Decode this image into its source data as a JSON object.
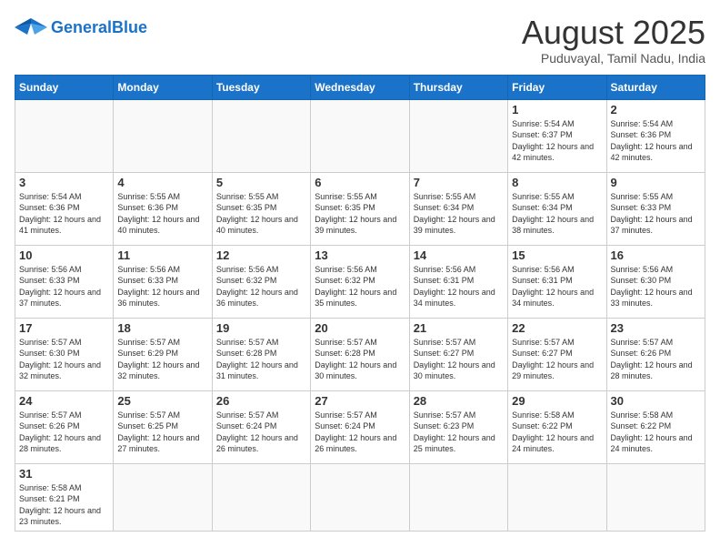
{
  "header": {
    "logo_text_general": "General",
    "logo_text_blue": "Blue",
    "title": "August 2025",
    "subtitle": "Puduvayal, Tamil Nadu, India"
  },
  "days_of_week": [
    "Sunday",
    "Monday",
    "Tuesday",
    "Wednesday",
    "Thursday",
    "Friday",
    "Saturday"
  ],
  "weeks": [
    [
      {
        "day": "",
        "info": ""
      },
      {
        "day": "",
        "info": ""
      },
      {
        "day": "",
        "info": ""
      },
      {
        "day": "",
        "info": ""
      },
      {
        "day": "",
        "info": ""
      },
      {
        "day": "1",
        "info": "Sunrise: 5:54 AM\nSunset: 6:37 PM\nDaylight: 12 hours and 42 minutes."
      },
      {
        "day": "2",
        "info": "Sunrise: 5:54 AM\nSunset: 6:36 PM\nDaylight: 12 hours and 42 minutes."
      }
    ],
    [
      {
        "day": "3",
        "info": "Sunrise: 5:54 AM\nSunset: 6:36 PM\nDaylight: 12 hours and 41 minutes."
      },
      {
        "day": "4",
        "info": "Sunrise: 5:55 AM\nSunset: 6:36 PM\nDaylight: 12 hours and 40 minutes."
      },
      {
        "day": "5",
        "info": "Sunrise: 5:55 AM\nSunset: 6:35 PM\nDaylight: 12 hours and 40 minutes."
      },
      {
        "day": "6",
        "info": "Sunrise: 5:55 AM\nSunset: 6:35 PM\nDaylight: 12 hours and 39 minutes."
      },
      {
        "day": "7",
        "info": "Sunrise: 5:55 AM\nSunset: 6:34 PM\nDaylight: 12 hours and 39 minutes."
      },
      {
        "day": "8",
        "info": "Sunrise: 5:55 AM\nSunset: 6:34 PM\nDaylight: 12 hours and 38 minutes."
      },
      {
        "day": "9",
        "info": "Sunrise: 5:55 AM\nSunset: 6:33 PM\nDaylight: 12 hours and 37 minutes."
      }
    ],
    [
      {
        "day": "10",
        "info": "Sunrise: 5:56 AM\nSunset: 6:33 PM\nDaylight: 12 hours and 37 minutes."
      },
      {
        "day": "11",
        "info": "Sunrise: 5:56 AM\nSunset: 6:33 PM\nDaylight: 12 hours and 36 minutes."
      },
      {
        "day": "12",
        "info": "Sunrise: 5:56 AM\nSunset: 6:32 PM\nDaylight: 12 hours and 36 minutes."
      },
      {
        "day": "13",
        "info": "Sunrise: 5:56 AM\nSunset: 6:32 PM\nDaylight: 12 hours and 35 minutes."
      },
      {
        "day": "14",
        "info": "Sunrise: 5:56 AM\nSunset: 6:31 PM\nDaylight: 12 hours and 34 minutes."
      },
      {
        "day": "15",
        "info": "Sunrise: 5:56 AM\nSunset: 6:31 PM\nDaylight: 12 hours and 34 minutes."
      },
      {
        "day": "16",
        "info": "Sunrise: 5:56 AM\nSunset: 6:30 PM\nDaylight: 12 hours and 33 minutes."
      }
    ],
    [
      {
        "day": "17",
        "info": "Sunrise: 5:57 AM\nSunset: 6:30 PM\nDaylight: 12 hours and 32 minutes."
      },
      {
        "day": "18",
        "info": "Sunrise: 5:57 AM\nSunset: 6:29 PM\nDaylight: 12 hours and 32 minutes."
      },
      {
        "day": "19",
        "info": "Sunrise: 5:57 AM\nSunset: 6:28 PM\nDaylight: 12 hours and 31 minutes."
      },
      {
        "day": "20",
        "info": "Sunrise: 5:57 AM\nSunset: 6:28 PM\nDaylight: 12 hours and 30 minutes."
      },
      {
        "day": "21",
        "info": "Sunrise: 5:57 AM\nSunset: 6:27 PM\nDaylight: 12 hours and 30 minutes."
      },
      {
        "day": "22",
        "info": "Sunrise: 5:57 AM\nSunset: 6:27 PM\nDaylight: 12 hours and 29 minutes."
      },
      {
        "day": "23",
        "info": "Sunrise: 5:57 AM\nSunset: 6:26 PM\nDaylight: 12 hours and 28 minutes."
      }
    ],
    [
      {
        "day": "24",
        "info": "Sunrise: 5:57 AM\nSunset: 6:26 PM\nDaylight: 12 hours and 28 minutes."
      },
      {
        "day": "25",
        "info": "Sunrise: 5:57 AM\nSunset: 6:25 PM\nDaylight: 12 hours and 27 minutes."
      },
      {
        "day": "26",
        "info": "Sunrise: 5:57 AM\nSunset: 6:24 PM\nDaylight: 12 hours and 26 minutes."
      },
      {
        "day": "27",
        "info": "Sunrise: 5:57 AM\nSunset: 6:24 PM\nDaylight: 12 hours and 26 minutes."
      },
      {
        "day": "28",
        "info": "Sunrise: 5:57 AM\nSunset: 6:23 PM\nDaylight: 12 hours and 25 minutes."
      },
      {
        "day": "29",
        "info": "Sunrise: 5:58 AM\nSunset: 6:22 PM\nDaylight: 12 hours and 24 minutes."
      },
      {
        "day": "30",
        "info": "Sunrise: 5:58 AM\nSunset: 6:22 PM\nDaylight: 12 hours and 24 minutes."
      }
    ],
    [
      {
        "day": "31",
        "info": "Sunrise: 5:58 AM\nSunset: 6:21 PM\nDaylight: 12 hours and 23 minutes."
      },
      {
        "day": "",
        "info": ""
      },
      {
        "day": "",
        "info": ""
      },
      {
        "day": "",
        "info": ""
      },
      {
        "day": "",
        "info": ""
      },
      {
        "day": "",
        "info": ""
      },
      {
        "day": "",
        "info": ""
      }
    ]
  ]
}
